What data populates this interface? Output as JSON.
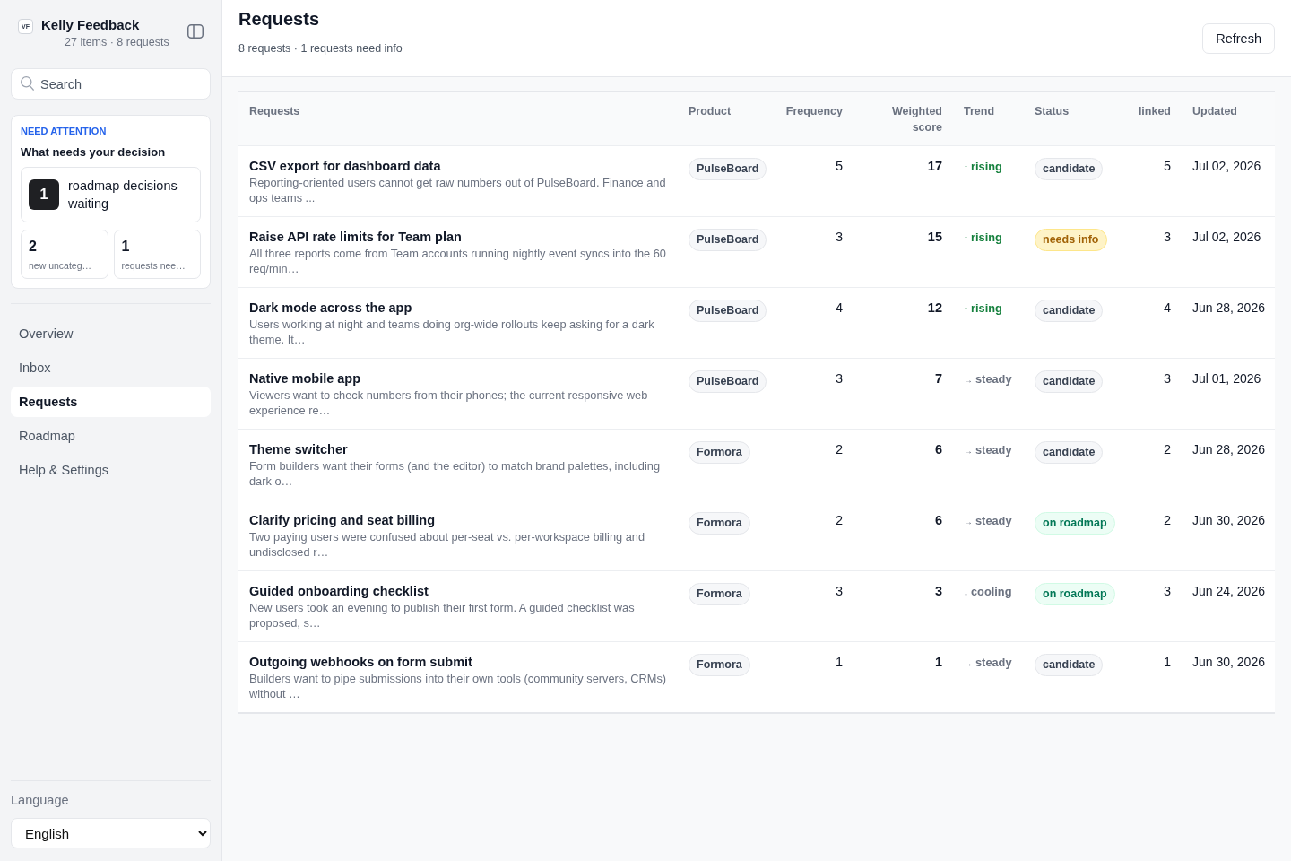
{
  "sidebar": {
    "brand": {
      "logo": "VF",
      "name": "Kelly Feedback",
      "summary": "27 items · 8 requests"
    },
    "search": {
      "placeholder": "Search"
    },
    "attention": {
      "eyebrow": "NEED ATTENTION",
      "heading": "What needs your decision",
      "primary": {
        "count": "1",
        "label": "roadmap decisions waiting"
      },
      "tiles": [
        {
          "count": "2",
          "label": "new uncateg…"
        },
        {
          "count": "1",
          "label": "requests nee…"
        }
      ]
    },
    "nav": [
      {
        "label": "Overview",
        "selected": false
      },
      {
        "label": "Inbox",
        "selected": false
      },
      {
        "label": "Requests",
        "selected": true
      },
      {
        "label": "Roadmap",
        "selected": false
      },
      {
        "label": "Help & Settings",
        "selected": false
      }
    ],
    "language": {
      "label": "Language",
      "value": "English"
    }
  },
  "header": {
    "title": "Requests",
    "subtitle": "8 requests · 1 requests need info",
    "refresh_button": "Refresh"
  },
  "table": {
    "columns": [
      "Requests",
      "Product",
      "Frequency",
      "Weighted score",
      "Trend",
      "Status",
      "linked",
      "Updated"
    ],
    "rows": [
      {
        "title": "CSV export for dashboard data",
        "description": "Reporting-oriented users cannot get raw numbers out of PulseBoard. Finance and ops teams ...",
        "product": "PulseBoard",
        "frequency": "5",
        "weighted_score": "17",
        "trend": {
          "kind": "rising",
          "arrow": "↑",
          "label": "rising"
        },
        "status": {
          "kind": "candidate",
          "label": "candidate"
        },
        "linked": "5",
        "updated": "Jul 02, 2026"
      },
      {
        "title": "Raise API rate limits for Team plan",
        "description": "All three reports come from Team accounts running nightly event syncs into the 60 req/min…",
        "product": "PulseBoard",
        "frequency": "3",
        "weighted_score": "15",
        "trend": {
          "kind": "rising",
          "arrow": "↑",
          "label": "rising"
        },
        "status": {
          "kind": "needs_info",
          "label": "needs info"
        },
        "linked": "3",
        "updated": "Jul 02, 2026"
      },
      {
        "title": "Dark mode across the app",
        "description": "Users working at night and teams doing org-wide rollouts keep asking for a dark theme. It…",
        "product": "PulseBoard",
        "frequency": "4",
        "weighted_score": "12",
        "trend": {
          "kind": "rising",
          "arrow": "↑",
          "label": "rising"
        },
        "status": {
          "kind": "candidate",
          "label": "candidate"
        },
        "linked": "4",
        "updated": "Jun 28, 2026"
      },
      {
        "title": "Native mobile app",
        "description": "Viewers want to check numbers from their phones; the current responsive web experience re…",
        "product": "PulseBoard",
        "frequency": "3",
        "weighted_score": "7",
        "trend": {
          "kind": "steady",
          "arrow": "→",
          "label": "steady"
        },
        "status": {
          "kind": "candidate",
          "label": "candidate"
        },
        "linked": "3",
        "updated": "Jul 01, 2026"
      },
      {
        "title": "Theme switcher",
        "description": "Form builders want their forms (and the editor) to match brand palettes, including dark o…",
        "product": "Formora",
        "frequency": "2",
        "weighted_score": "6",
        "trend": {
          "kind": "steady",
          "arrow": "→",
          "label": "steady"
        },
        "status": {
          "kind": "candidate",
          "label": "candidate"
        },
        "linked": "2",
        "updated": "Jun 28, 2026"
      },
      {
        "title": "Clarify pricing and seat billing",
        "description": "Two paying users were confused about per-seat vs. per-workspace billing and undisclosed r…",
        "product": "Formora",
        "frequency": "2",
        "weighted_score": "6",
        "trend": {
          "kind": "steady",
          "arrow": "→",
          "label": "steady"
        },
        "status": {
          "kind": "roadmap",
          "label": "on roadmap"
        },
        "linked": "2",
        "updated": "Jun 30, 2026"
      },
      {
        "title": "Guided onboarding checklist",
        "description": "New users took an evening to publish their first form. A guided checklist was proposed, s…",
        "product": "Formora",
        "frequency": "3",
        "weighted_score": "3",
        "trend": {
          "kind": "cooling",
          "arrow": "↓",
          "label": "cooling"
        },
        "status": {
          "kind": "roadmap",
          "label": "on roadmap"
        },
        "linked": "3",
        "updated": "Jun 24, 2026"
      },
      {
        "title": "Outgoing webhooks on form submit",
        "description": "Builders want to pipe submissions into their own tools (community servers, CRMs) without …",
        "product": "Formora",
        "frequency": "1",
        "weighted_score": "1",
        "trend": {
          "kind": "steady",
          "arrow": "→",
          "label": "steady"
        },
        "status": {
          "kind": "candidate",
          "label": "candidate"
        },
        "linked": "1",
        "updated": "Jun 30, 2026"
      }
    ]
  }
}
